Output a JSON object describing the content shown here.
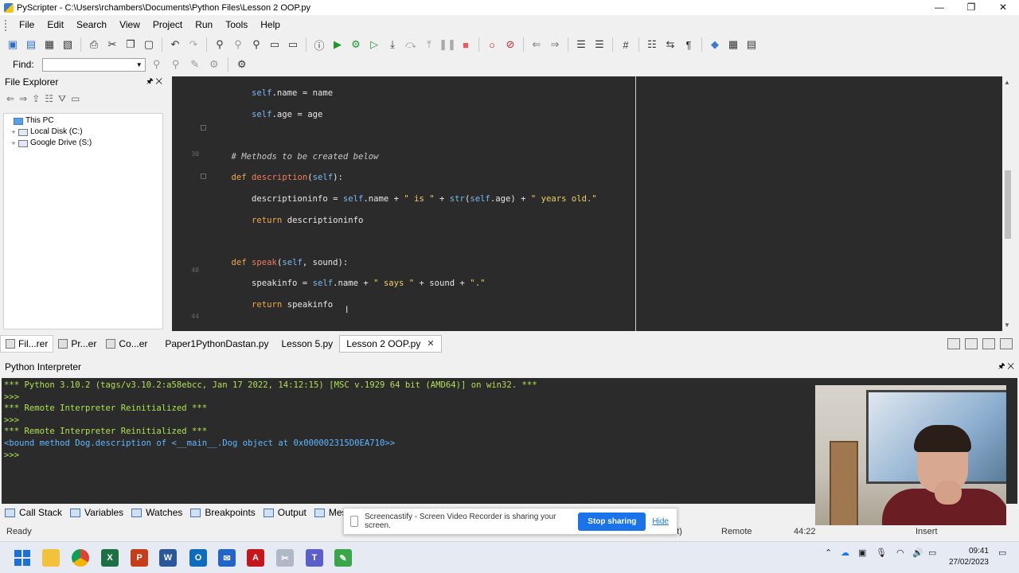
{
  "window": {
    "title": "PyScripter - C:\\Users\\rchambers\\Documents\\Python Files\\Lesson 2 OOP.py",
    "minimize": "—",
    "maximize": "❐",
    "close": "✕"
  },
  "menu": [
    "File",
    "Edit",
    "Search",
    "View",
    "Project",
    "Run",
    "Tools",
    "Help"
  ],
  "find": {
    "label": "Find:",
    "value": ""
  },
  "explorer": {
    "title": "File Explorer",
    "items": [
      {
        "expander": "",
        "label": "This PC"
      },
      {
        "expander": "+",
        "label": "Local Disk (C:)"
      },
      {
        "expander": "+",
        "label": "Google Drive (S:)"
      }
    ]
  },
  "editor": {
    "gutter_numbers": [
      {
        "label": "30",
        "row": 6
      },
      {
        "label": "40",
        "row": 16
      },
      {
        "label": "44",
        "row": 20
      }
    ],
    "cursor": "I"
  },
  "left_tabs": [
    {
      "label": "Fil...rer",
      "active": true
    },
    {
      "label": "Pr...er",
      "active": false
    },
    {
      "label": "Co...er",
      "active": false
    }
  ],
  "file_tabs": [
    {
      "label": "Paper1PythonDastan.py",
      "active": false
    },
    {
      "label": "Lesson 5.py",
      "active": false
    },
    {
      "label": "Lesson 2 OOP.py",
      "active": true
    }
  ],
  "interpreter": {
    "title": "Python Interpreter",
    "lines": [
      {
        "text": "*** Python 3.10.2 (tags/v3.10.2:a58ebcc, Jan 17 2022, 14:12:15) [MSC v.1929 64 bit (AMD64)] on win32. ***",
        "color": "green"
      },
      {
        "text": ">>>",
        "color": "green"
      },
      {
        "text": "*** Remote Interpreter Reinitialized ***",
        "color": "green"
      },
      {
        "text": ">>>",
        "color": "green"
      },
      {
        "text": "*** Remote Interpreter Reinitialized ***",
        "color": "green"
      },
      {
        "text": "<bound method Dog.description of <__main__.Dog object at 0x000002315D0EA710>>",
        "color": "blue"
      },
      {
        "text": ">>>",
        "color": "green"
      }
    ]
  },
  "bottom_tabs": [
    "Call Stack",
    "Variables",
    "Watches",
    "Breakpoints",
    "Output",
    "Mess"
  ],
  "screencastify": {
    "message": "Screencastify - Screen Video Recorder is sharing your screen.",
    "stop_label": "Stop sharing",
    "hide_label": "Hide"
  },
  "status": {
    "ready": "Ready",
    "bits": "-bit)",
    "mode": "Remote",
    "position": "44:22",
    "insert": "Insert"
  },
  "clock": {
    "time": "09:41",
    "date": "27/02/2023"
  },
  "taskbar_apps": [
    "folder",
    "chrome",
    "excel",
    "powerpoint",
    "word",
    "outlook",
    "mail",
    "acrobat",
    "snipping",
    "teams",
    "pyscripter"
  ]
}
